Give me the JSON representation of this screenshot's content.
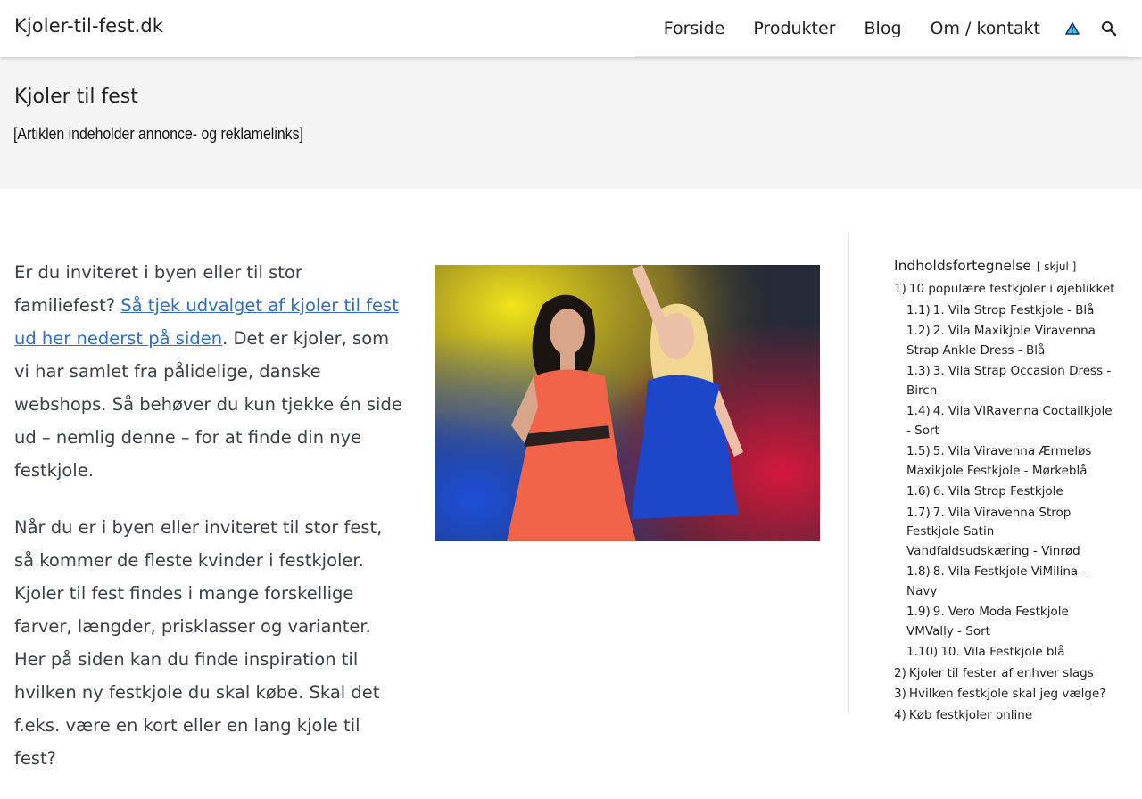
{
  "header": {
    "site_title": "Kjoler-til-fest.dk",
    "nav": [
      "Forside",
      "Produkter",
      "Blog",
      "Om / kontakt"
    ],
    "icons": [
      "warning-triangle-icon",
      "search-icon"
    ]
  },
  "hero": {
    "title": "Kjoler til fest",
    "disclaimer": "[Artiklen indeholder annonce- og reklamelinks]"
  },
  "intro": {
    "p1_start": "Er du inviteret i byen eller til stor familiefest? ",
    "p1_link": "Så tjek udvalget af kjoler til fest ud her nederst på siden",
    "p1_end": ". Det er kjoler, som vi har samlet fra pålidelige, danske webshops. Så behøver du kun tjekke én side ud – nemlig denne – for at finde din nye festkjole.",
    "p2": "Når du er i byen eller inviteret til stor fest, så kommer de fleste kvinder i festkjoler. Kjoler til fest findes i mange forskellige farver, længder, prisklasser og varianter. Her på siden kan du finde inspiration til hvilken ny festkjole du skal købe. Skal det f.eks. være en kort eller en lang kjole til fest?"
  },
  "toc": {
    "title": "Indholdsfortegnelse",
    "toggle": "[ skjul ]",
    "items": [
      {
        "num": "1)",
        "label": "10 populære festkjoler i øjeblikket",
        "level": 1
      },
      {
        "num": "1.1)",
        "label": "1. Vila Strop Festkjole - Blå",
        "level": 2
      },
      {
        "num": "1.2)",
        "label": "2. Vila Maxikjole Viravenna Strap Ankle Dress - Blå",
        "level": 2
      },
      {
        "num": "1.3)",
        "label": "3. Vila Strap Occasion Dress - Birch",
        "level": 2
      },
      {
        "num": "1.4)",
        "label": "4. Vila VIRavenna Coctailkjole - Sort",
        "level": 2
      },
      {
        "num": "1.5)",
        "label": "5. Vila Viravenna Ærmeløs Maxikjole Festkjole - Mørkeblå",
        "level": 2
      },
      {
        "num": "1.6)",
        "label": "6. Vila Strop Festkjole",
        "level": 2
      },
      {
        "num": "1.7)",
        "label": "7. Vila Viravenna Strop Festkjole Satin Vandfaldsudskæring - Vinrød",
        "level": 2
      },
      {
        "num": "1.8)",
        "label": "8. Vila Festkjole ViMilina - Navy",
        "level": 2
      },
      {
        "num": "1.9)",
        "label": "9. Vero Moda Festkjole VMVally - Sort",
        "level": 2
      },
      {
        "num": "1.10)",
        "label": "10. Vila Festkjole blå",
        "level": 2
      },
      {
        "num": "2)",
        "label": "Kjoler til fester af enhver slags",
        "level": 1
      },
      {
        "num": "3)",
        "label": "Hvilken festkjole skal jeg vælge?",
        "level": 1
      },
      {
        "num": "4)",
        "label": "Køb festkjoler online",
        "level": 1
      }
    ]
  }
}
